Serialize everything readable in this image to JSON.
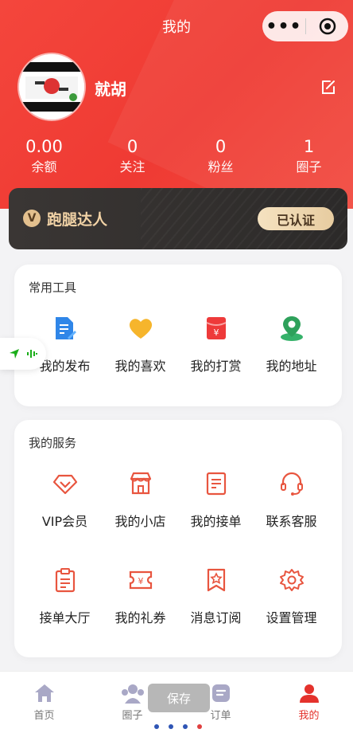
{
  "header": {
    "title": "我的",
    "username": "就胡"
  },
  "stats": [
    {
      "value": "0.00",
      "label": "余额"
    },
    {
      "value": "0",
      "label": "关注"
    },
    {
      "value": "0",
      "label": "粉丝"
    },
    {
      "value": "1",
      "label": "圈子"
    }
  ],
  "vip": {
    "badge": "V",
    "title": "跑腿达人",
    "button": "已认证"
  },
  "tools": {
    "title": "常用工具",
    "items": [
      {
        "label": "我的发布",
        "icon": "document-edit-icon"
      },
      {
        "label": "我的喜欢",
        "icon": "heart-icon"
      },
      {
        "label": "我的打赏",
        "icon": "red-envelope-icon"
      },
      {
        "label": "我的地址",
        "icon": "location-pin-icon"
      }
    ]
  },
  "services": {
    "title": "我的服务",
    "row1": [
      {
        "label": "VIP会员",
        "icon": "diamond-icon"
      },
      {
        "label": "我的小店",
        "icon": "shop-icon"
      },
      {
        "label": "我的接单",
        "icon": "order-sheet-icon"
      },
      {
        "label": "联系客服",
        "icon": "headset-icon"
      }
    ],
    "row2": [
      {
        "label": "接单大厅",
        "icon": "clipboard-icon"
      },
      {
        "label": "我的礼券",
        "icon": "coupon-icon"
      },
      {
        "label": "消息订阅",
        "icon": "star-bookmark-icon"
      },
      {
        "label": "设置管理",
        "icon": "gear-icon"
      }
    ]
  },
  "tabbar": [
    {
      "label": "首页",
      "icon": "home-icon"
    },
    {
      "label": "圈子",
      "icon": "group-icon"
    },
    {
      "label": "订单",
      "icon": "order-icon"
    },
    {
      "label": "我的",
      "icon": "user-icon",
      "active": true
    }
  ],
  "overlay": {
    "save": "保存"
  },
  "colors": {
    "brand_red": "#ef3a33",
    "gold": "#e3c08e",
    "icon_orange": "#e8553f"
  }
}
